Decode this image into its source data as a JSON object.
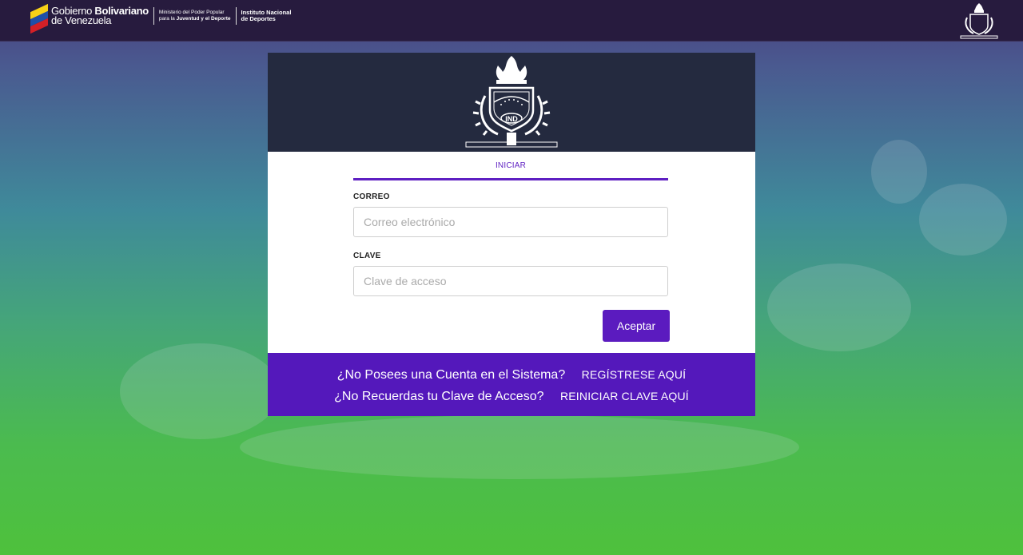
{
  "header": {
    "gov_name_line1": "Gobierno",
    "gov_name_bold": "Bolivariano",
    "gov_name_line2": "de Venezuela",
    "ministry_line1": "Ministerio del Poder Popular",
    "ministry_line2_pre": "para la",
    "ministry_line2_bold": "Juventud y el Deporte",
    "institute_line1": "Instituto Nacional",
    "institute_line2": "de Deportes"
  },
  "emblem": {
    "badge_text": "IND",
    "icon": "ind-emblem-icon"
  },
  "login": {
    "tab_label": "INICIAR",
    "email_label": "CORREO",
    "email_placeholder": "Correo electrónico",
    "email_value": "",
    "password_label": "CLAVE",
    "password_placeholder": "Clave de acceso",
    "password_value": "",
    "submit_label": "Aceptar"
  },
  "footer": {
    "register_question": "¿No Posees una Cuenta en el Sistema?",
    "register_link": "REGÍSTRESE AQUÍ",
    "reset_question": "¿No Recuerdas tu Clave de Acceso?",
    "reset_link": "REINICIAR CLAVE AQUÍ"
  },
  "colors": {
    "topbar": "#271b3e",
    "card_header": "#242a3f",
    "accent": "#5b1bbf",
    "footer": "#5418bb"
  }
}
